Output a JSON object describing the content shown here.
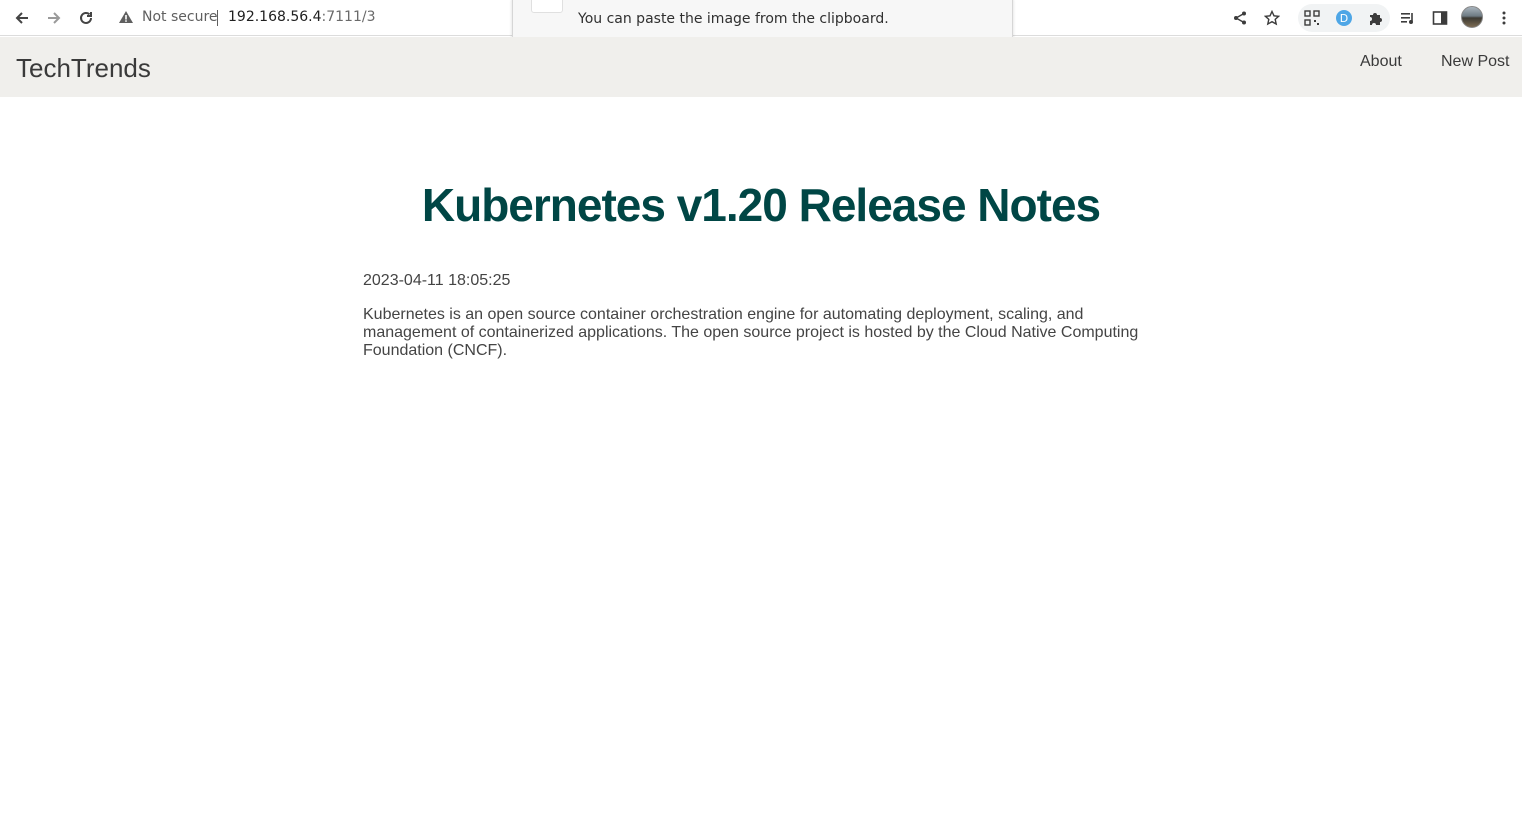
{
  "browser": {
    "security_label": "Not secure",
    "url_host": "192.168.56.4",
    "url_path": ":7111/3",
    "icons": [
      "back-icon",
      "forward-icon",
      "reload-icon",
      "warning-icon",
      "share-icon",
      "star-icon",
      "qr-extension-icon",
      "d-extension-icon",
      "puzzle-icon",
      "media-icon",
      "side-panel-icon",
      "avatar",
      "kebab-menu-icon"
    ]
  },
  "popup": {
    "message": "You can paste the image from the clipboard."
  },
  "site": {
    "brand": "TechTrends",
    "nav": {
      "about": "About",
      "new_post": "New Post"
    }
  },
  "post": {
    "title": "Kubernetes v1.20 Release Notes",
    "created": "2023-04-11 18:05:25",
    "content": "Kubernetes is an open source container orchestration engine for automating deployment, scaling, and management of containerized applications. The open source project is hosted by the Cloud Native Computing Foundation (CNCF)."
  },
  "colors": {
    "title": "#004645",
    "navbar_bg": "#f0efec",
    "text": "#444444"
  }
}
